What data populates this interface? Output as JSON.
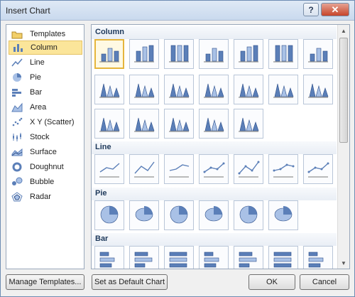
{
  "window": {
    "title": "Insert Chart",
    "help_glyph": "?",
    "close_glyph": "✕"
  },
  "sidebar": {
    "items": [
      {
        "label": "Templates",
        "icon": "folder-icon"
      },
      {
        "label": "Column",
        "icon": "column-chart-icon",
        "selected": true
      },
      {
        "label": "Line",
        "icon": "line-chart-icon"
      },
      {
        "label": "Pie",
        "icon": "pie-chart-icon"
      },
      {
        "label": "Bar",
        "icon": "bar-chart-icon"
      },
      {
        "label": "Area",
        "icon": "area-chart-icon"
      },
      {
        "label": "X Y (Scatter)",
        "icon": "scatter-chart-icon"
      },
      {
        "label": "Stock",
        "icon": "stock-chart-icon"
      },
      {
        "label": "Surface",
        "icon": "surface-chart-icon"
      },
      {
        "label": "Doughnut",
        "icon": "doughnut-chart-icon"
      },
      {
        "label": "Bubble",
        "icon": "bubble-chart-icon"
      },
      {
        "label": "Radar",
        "icon": "radar-chart-icon"
      }
    ]
  },
  "gallery": {
    "sections": [
      {
        "title": "Column",
        "count": 19
      },
      {
        "title": "Line",
        "count": 7
      },
      {
        "title": "Pie",
        "count": 6
      },
      {
        "title": "Bar",
        "count": 7
      }
    ]
  },
  "footer": {
    "manage_templates": "Manage Templates...",
    "set_default": "Set as Default Chart",
    "ok": "OK",
    "cancel": "Cancel"
  },
  "colors": {
    "accent_selected": "#fbe59a",
    "thumb_blue": "#5b7fb8",
    "thumb_light": "#a9c1e6"
  }
}
